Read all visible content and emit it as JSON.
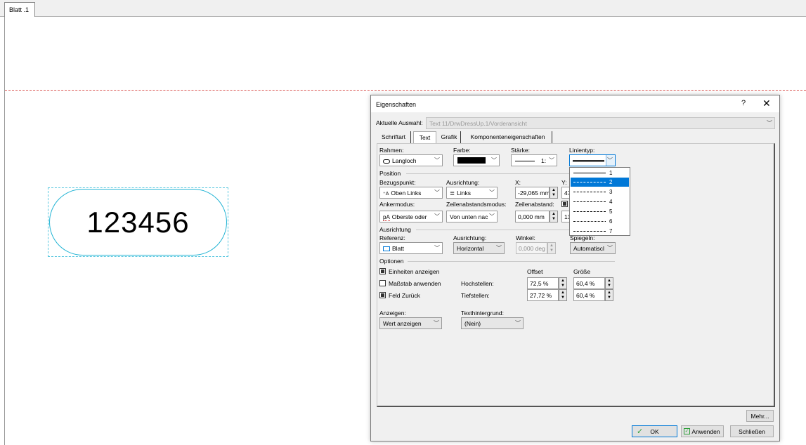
{
  "sheet": {
    "tab_label": "Blatt .1",
    "text_value": "123456"
  },
  "dialog": {
    "title": "Eigenschaften",
    "help_glyph": "?",
    "close_glyph": "✕",
    "current_selection_label": "Aktuelle Auswahl:",
    "current_selection_value": "Text 11/DrwDressUp.1/Vorderansicht",
    "tabs": [
      "Schriftart",
      "Text",
      "Grafik",
      "Komponenteneigenschaften"
    ],
    "active_tab": "Text",
    "frame": {
      "rahmen_label": "Rahmen:",
      "rahmen_value": "Langloch",
      "farbe_label": "Farbe:",
      "staerke_label": "Stärke:",
      "staerke_value": "1:",
      "linientyp_label": "Linientyp:"
    },
    "position": {
      "header": "Position",
      "bezugspunkt_label": "Bezugspunkt:",
      "bezugspunkt_value": "Oben Links",
      "ausrichtung_label": "Ausrichtung:",
      "ausrichtung_value": "Links",
      "x_label": "X:",
      "x_value": "-29,065 mm",
      "y_label": "Y:",
      "y_value": "47",
      "ankermodus_label": "Ankermodus:",
      "ankermodus_value": "Oberste oder",
      "zeilenabstandsmodus_label": "Zeilenabstandsmodus:",
      "zeilenabstandsmodus_value": "Von unten nac",
      "zeilenabstand_label": "Zeilenabstand:",
      "zeilenabstand_value": "0,000 mm",
      "extra_value": "13"
    },
    "ausrichtung": {
      "header": "Ausrichtung",
      "referenz_label": "Referenz:",
      "referenz_value": "Blatt",
      "ausrichtung_label": "Ausrichtung:",
      "ausrichtung_value": "Horizontal",
      "winkel_label": "Winkel:",
      "winkel_value": "0,000 deg",
      "spiegeln_label": "Spiegeln:",
      "spiegeln_value": "Automatiscl"
    },
    "optionen": {
      "header": "Optionen",
      "einheiten": {
        "label": "Einheiten anzeigen",
        "checked": true
      },
      "massstab": {
        "label": "Maßstab anwenden",
        "checked": false
      },
      "feld_zurueck": {
        "label": "Feld Zurück",
        "checked": true
      },
      "offset_header": "Offset",
      "groesse_header": "Größe",
      "hochstellen_label": "Hochstellen:",
      "hochstellen_offset": "72,5 %",
      "hochstellen_groesse": "60,4 %",
      "tiefstellen_label": "Tiefstellen:",
      "tiefstellen_offset": "27,72 %",
      "tiefstellen_groesse": "60,4 %"
    },
    "anzeigen_label": "Anzeigen:",
    "anzeigen_value": "Wert anzeigen",
    "texthintergrund_label": "Texthintergrund:",
    "texthintergrund_value": "(Nein)",
    "linetype_options": [
      "1",
      "2",
      "3",
      "4",
      "5",
      "6",
      "7"
    ],
    "linetype_selected": "2",
    "buttons": {
      "mehr": "Mehr...",
      "ok": "OK",
      "anwenden": "Anwenden",
      "schliessen": "Schließen"
    },
    "colors": {
      "selection": "#0078d7",
      "frame_color": "#000000",
      "ok_check": "#2e9e3a"
    }
  }
}
